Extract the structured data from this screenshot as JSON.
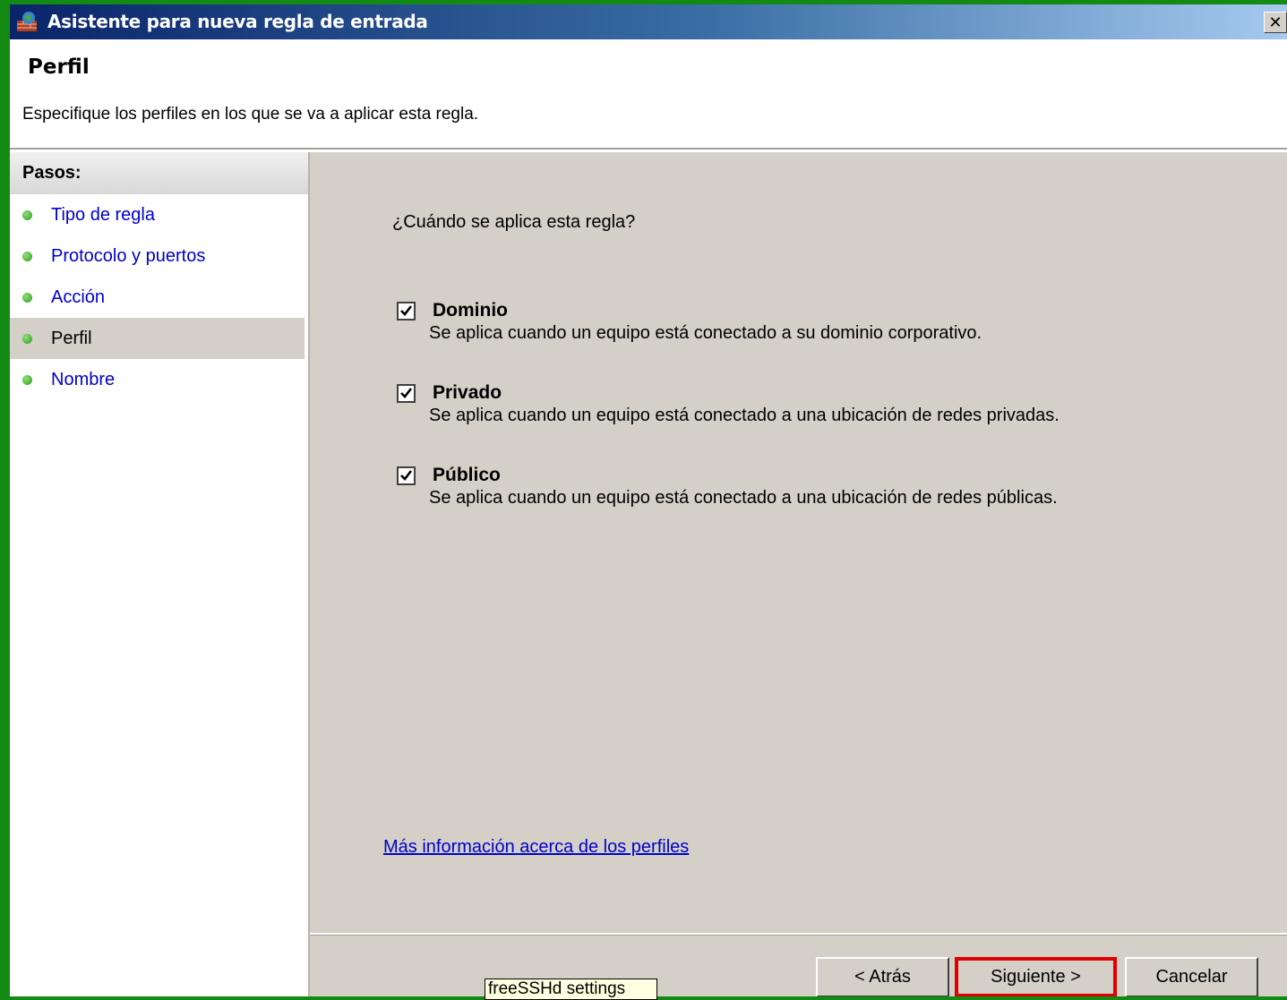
{
  "window": {
    "title": "Asistente para nueva regla de entrada",
    "close_symbol": "✕"
  },
  "header": {
    "title": "Perfil",
    "description": "Especifique los perfiles en los que se va a aplicar esta regla."
  },
  "steps": {
    "heading": "Pasos:",
    "items": [
      {
        "label": "Tipo de regla",
        "current": false
      },
      {
        "label": "Protocolo y puertos",
        "current": false
      },
      {
        "label": "Acción",
        "current": false
      },
      {
        "label": "Perfil",
        "current": true
      },
      {
        "label": "Nombre",
        "current": false
      }
    ]
  },
  "content": {
    "question": "¿Cuándo se aplica esta regla?",
    "options": [
      {
        "name": "Dominio",
        "description": "Se aplica cuando un equipo está conectado a su dominio corporativo.",
        "checked": true
      },
      {
        "name": "Privado",
        "description": "Se aplica cuando un equipo está conectado a una ubicación de redes privadas.",
        "checked": true
      },
      {
        "name": "Público",
        "description": "Se aplica cuando un equipo está conectado a una ubicación de redes públicas.",
        "checked": true
      }
    ],
    "more_info_link": "Más información acerca de los perfiles"
  },
  "buttons": {
    "back": "< Atrás",
    "next": "Siguiente >",
    "cancel": "Cancelar"
  },
  "tooltip": "freeSSHd settings",
  "colors": {
    "desktop": "#138a13",
    "highlight_border": "#e00000",
    "link": "#0000cc",
    "panel": "#d4d0c8"
  },
  "icons": {
    "title": "firewall-icon",
    "step_bullet": "green-dot-icon",
    "checkbox": "checkmark-icon"
  }
}
